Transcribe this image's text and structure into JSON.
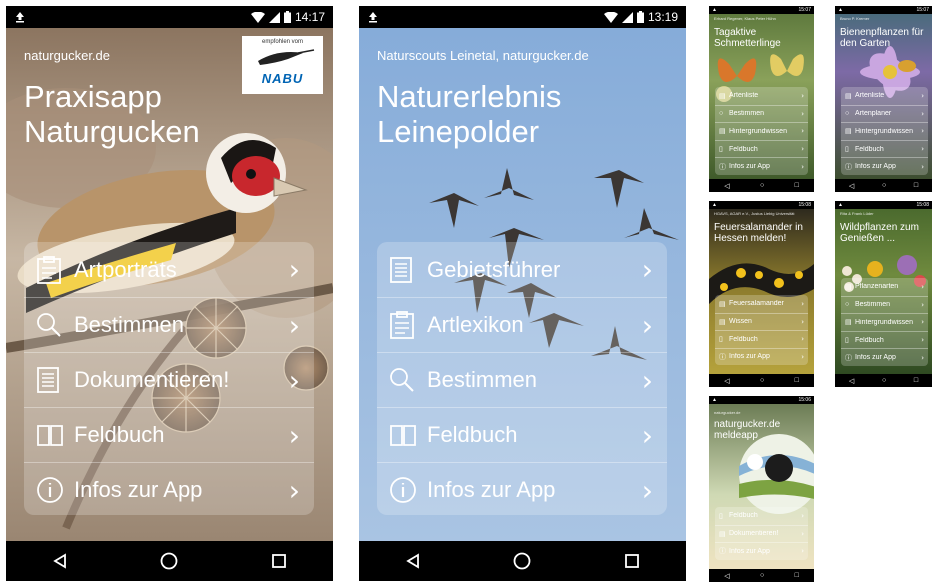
{
  "phone1": {
    "status_time": "14:17",
    "org": "naturgucker.de",
    "nabu_small": "empfohlen vom",
    "nabu_logo": "NABU",
    "title_line1": "Praxisapp",
    "title_line2": "Naturgucken",
    "menu": [
      {
        "label": "Artporträts",
        "icon": "clipboard-icon"
      },
      {
        "label": "Bestimmen",
        "icon": "search-icon"
      },
      {
        "label": "Dokumentieren!",
        "icon": "document-icon"
      },
      {
        "label": "Feldbuch",
        "icon": "book-icon"
      },
      {
        "label": "Infos zur App",
        "icon": "info-icon"
      }
    ]
  },
  "phone2": {
    "status_time": "13:19",
    "org": "Naturscouts Leinetal, naturgucker.de",
    "title_line1": "Naturerlebnis",
    "title_line2": "Leinepolder",
    "menu": [
      {
        "label": "Gebietsführer",
        "icon": "document-icon"
      },
      {
        "label": "Artlexikon",
        "icon": "clipboard-icon"
      },
      {
        "label": "Bestimmen",
        "icon": "search-icon"
      },
      {
        "label": "Feldbuch",
        "icon": "book-icon"
      },
      {
        "label": "Infos zur App",
        "icon": "info-icon"
      }
    ]
  },
  "thumb1": {
    "status_time": "15:07",
    "org": "Erhard Regener, Klaus Peter Hühn",
    "title_line1": "Tagaktive",
    "title_line2": "Schmetterlinge",
    "menu": [
      "Artenliste",
      "Bestimmen",
      "Hintergrundwissen",
      "Feldbuch",
      "Infos zur App"
    ]
  },
  "thumb2": {
    "status_time": "15:07",
    "org": "Bruno P. Kremer",
    "title_line1": "Bienenpflanzen für",
    "title_line2": "den Garten",
    "menu": [
      "Artenliste",
      "Artenplaner",
      "Hintergrundwissen",
      "Feldbuch",
      "Infos zur App"
    ]
  },
  "thumb3": {
    "status_time": "15:08",
    "org": "HGAVS, AGAR e.V., Justus Liebig Universität",
    "title_line1": "Feuersalamander in",
    "title_line2": "Hessen melden!",
    "menu": [
      "Feuersalamander",
      "Wissen",
      "Feldbuch",
      "Infos zur App"
    ]
  },
  "thumb4": {
    "status_time": "15:08",
    "org": "Rita & Frank Lüder",
    "title_line1": "Wildpflanzen zum",
    "title_line2": "Genießen ...",
    "menu": [
      "Pflanzenarten",
      "Bestimmen",
      "Hintergrundwissen",
      "Feldbuch",
      "Infos zur App"
    ]
  },
  "thumb5": {
    "status_time": "15:06",
    "org": "naturgucker.de",
    "title_line1": "naturgucker.de",
    "title_line2": "meldeapp",
    "menu": [
      "Feldbuch",
      "Dokumentieren!",
      "Infos zur App"
    ]
  },
  "chevron": "›",
  "colors": {
    "menu_bg": "rgba(255,255,255,0.22)",
    "sky": "#8fb3dc",
    "status_black": "#000000"
  }
}
